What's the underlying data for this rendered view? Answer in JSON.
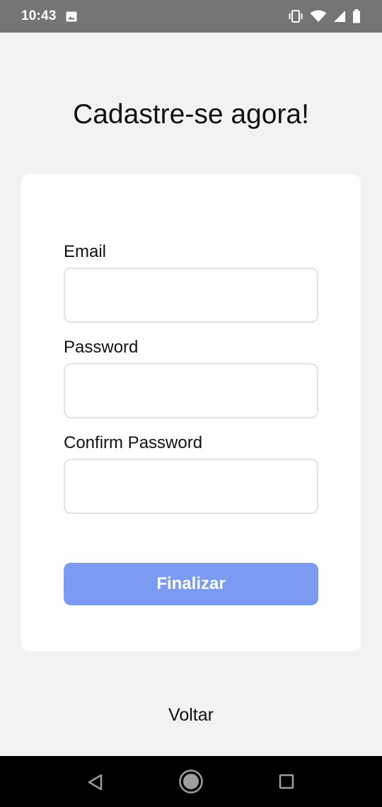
{
  "status_bar": {
    "time": "10:43",
    "icons": [
      "photo-icon",
      "vibrate-icon",
      "wifi-icon",
      "signal-icon",
      "battery-icon"
    ]
  },
  "page": {
    "title": "Cadastre-se agora!"
  },
  "form": {
    "email": {
      "label": "Email",
      "value": "",
      "placeholder": ""
    },
    "password": {
      "label": "Password",
      "value": "",
      "placeholder": ""
    },
    "confirm_password": {
      "label": "Confirm Password",
      "value": "",
      "placeholder": ""
    },
    "submit_label": "Finalizar"
  },
  "back_label": "Voltar",
  "nav_bar": {
    "icons": [
      "back-icon",
      "home-icon",
      "recents-icon"
    ]
  },
  "colors": {
    "status_bar": "#757575",
    "background": "#f2f2f2",
    "card": "#ffffff",
    "accent_button": "#7b9af2",
    "input_border": "#e2e2e2",
    "nav_bar": "#000000"
  }
}
